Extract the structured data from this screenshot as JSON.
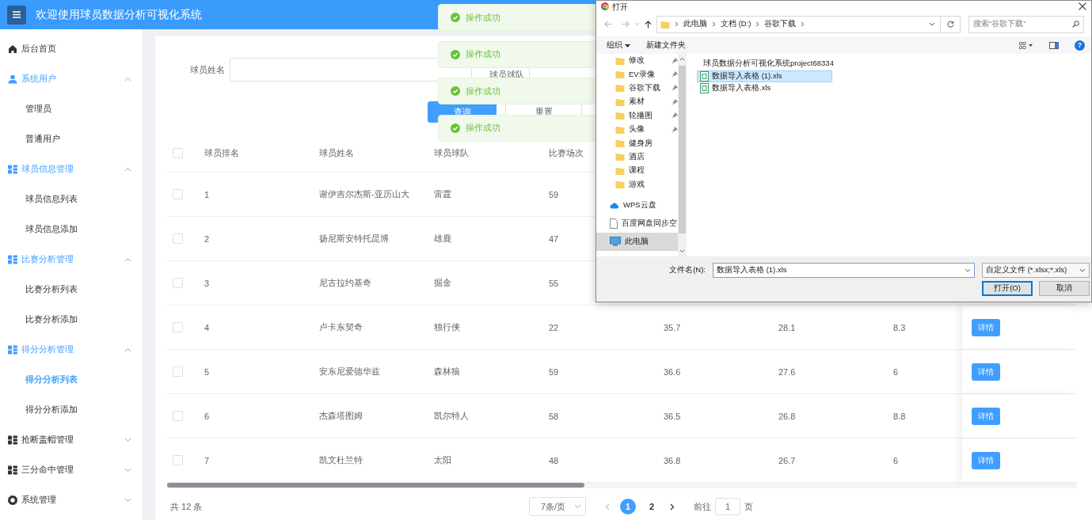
{
  "header": {
    "title": "欢迎使用球员数据分析可视化系统"
  },
  "sidebar": {
    "items": [
      {
        "label": "后台首页",
        "kind": "home"
      },
      {
        "label": "系统用户",
        "kind": "users",
        "expanded": true,
        "children": [
          {
            "label": "管理员",
            "selected": false
          },
          {
            "label": "普通用户",
            "selected": false
          }
        ]
      },
      {
        "label": "球员信息管理",
        "kind": "module",
        "expanded": true,
        "children": [
          {
            "label": "球员信息列表",
            "selected": false
          },
          {
            "label": "球员信息添加",
            "selected": false
          }
        ]
      },
      {
        "label": "比赛分析管理",
        "kind": "module",
        "expanded": true,
        "children": [
          {
            "label": "比赛分析列表",
            "selected": false
          },
          {
            "label": "比赛分析添加",
            "selected": false
          }
        ]
      },
      {
        "label": "得分分析管理",
        "kind": "module",
        "expanded": true,
        "children": [
          {
            "label": "得分分析列表",
            "selected": true
          },
          {
            "label": "得分分析添加",
            "selected": false
          }
        ]
      },
      {
        "label": "抢断盖帽管理",
        "kind": "module",
        "expanded": false
      },
      {
        "label": "三分命中管理",
        "kind": "module",
        "expanded": false
      },
      {
        "label": "系统管理",
        "kind": "settings",
        "expanded": false
      }
    ]
  },
  "search": {
    "fields": [
      {
        "label": "球员姓名"
      },
      {
        "label": "球员球队"
      }
    ],
    "buttons": [
      {
        "label": "查询",
        "kind": "query"
      },
      {
        "label": "重置",
        "kind": "reset"
      }
    ]
  },
  "table": {
    "select_all": {
      "checked": false
    },
    "columns": [
      "球员排名",
      "球员姓名",
      "球员球队",
      "比赛场次"
    ],
    "rows": [
      {
        "checked": false,
        "cells": [
          "1",
          "谢伊吉尔杰斯-亚历山大",
          "雷霆",
          "59"
        ]
      },
      {
        "checked": false,
        "cells": [
          "2",
          "扬尼斯安特托昆博",
          "雄鹿",
          "47"
        ]
      },
      {
        "checked": false,
        "cells": [
          "3",
          "尼古拉约基奇",
          "掘金",
          "55"
        ]
      },
      {
        "checked": false,
        "cells": [
          "4",
          "卢卡东契奇",
          "独行侠",
          "22",
          "35.7",
          "28.1",
          "8.3"
        ],
        "action": "详情"
      },
      {
        "checked": false,
        "cells": [
          "5",
          "安东尼爱德华兹",
          "森林狼",
          "59",
          "36.6",
          "27.6",
          "6"
        ],
        "action": "详情"
      },
      {
        "checked": false,
        "cells": [
          "6",
          "杰森塔图姆",
          "凯尔特人",
          "58",
          "36.5",
          "26.8",
          "8.8"
        ],
        "action": "详情"
      },
      {
        "checked": false,
        "cells": [
          "7",
          "凯文杜兰特",
          "太阳",
          "48",
          "36.8",
          "26.7",
          "6"
        ],
        "action": "详情"
      }
    ]
  },
  "pagination": {
    "total": "共 12 条",
    "page_size": "7条/页",
    "pages": [
      {
        "label": "1",
        "selected": true
      },
      {
        "label": "2",
        "selected": false
      }
    ],
    "goto_label": "前往",
    "goto_value": "1",
    "goto_suffix": "页"
  },
  "toasts": [
    {
      "text": "操作成功"
    },
    {
      "text": "操作成功"
    },
    {
      "text": "操作成功"
    },
    {
      "text": "操作成功"
    }
  ],
  "dialog": {
    "title": "打开",
    "breadcrumb": [
      "此电脑",
      "文档 (D:)",
      "谷歌下载"
    ],
    "search_placeholder": "搜索“谷歌下载”",
    "organize": "组织",
    "new_folder": "新建文件夹",
    "help": "?",
    "nav": [
      {
        "label": "修改",
        "kind": "folder",
        "pinned": true,
        "selected": false
      },
      {
        "label": "EV录像",
        "kind": "folder",
        "pinned": true,
        "selected": false
      },
      {
        "label": "谷歌下载",
        "kind": "folder",
        "pinned": true,
        "selected": false
      },
      {
        "label": "素材",
        "kind": "folder",
        "pinned": true,
        "selected": false
      },
      {
        "label": "轮播图",
        "kind": "folder",
        "pinned": true,
        "selected": false
      },
      {
        "label": "头像",
        "kind": "folder",
        "pinned": true,
        "selected": false
      },
      {
        "label": "健身房",
        "kind": "folder",
        "pinned": false,
        "selected": false
      },
      {
        "label": "酒店",
        "kind": "folder",
        "pinned": false,
        "selected": false
      },
      {
        "label": "课程",
        "kind": "folder",
        "pinned": false,
        "selected": false
      },
      {
        "label": "游戏",
        "kind": "folder",
        "pinned": false,
        "selected": false
      },
      {
        "label": "WPS云盘",
        "kind": "cloud",
        "pinned": false,
        "selected": false
      },
      {
        "label": "百度网盘同步空",
        "kind": "file",
        "pinned": false,
        "selected": false
      },
      {
        "label": "此电脑",
        "kind": "computer",
        "pinned": false,
        "selected": true
      }
    ],
    "files": [
      {
        "name": "球员数据分析可视化系统project68334",
        "kind": "folder",
        "selected": false
      },
      {
        "name": "数据导入表格 (1).xls",
        "kind": "sheet",
        "selected": true
      },
      {
        "name": "数据导入表格.xls",
        "kind": "sheet",
        "selected": false
      }
    ],
    "filename_label": "文件名(N):",
    "filename_value": "数据导入表格 (1).xls",
    "filter": "自定义文件 (*.xlsx;*.xls)",
    "buttons": [
      {
        "label": "打开(O)",
        "kind": "default"
      },
      {
        "label": "取消",
        "kind": "normal"
      }
    ]
  }
}
